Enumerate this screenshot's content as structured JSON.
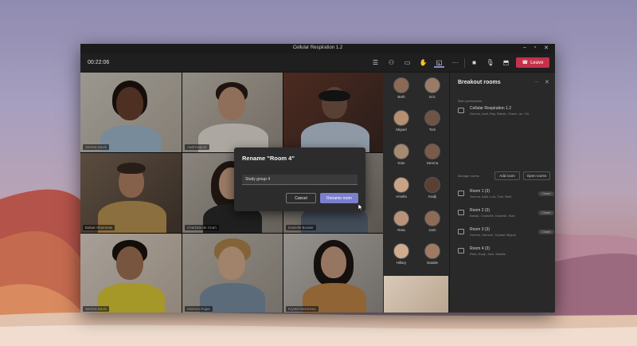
{
  "window": {
    "title": "Cellular Respiration 1.2"
  },
  "toolbar": {
    "timer": "00:22:06",
    "leave_label": "Leave",
    "icons": [
      "list-icon",
      "people-icon",
      "chat-icon",
      "raise-hand-icon",
      "breakout-rooms-icon",
      "more-icon",
      "camera-icon",
      "mic-icon",
      "share-icon"
    ]
  },
  "grid": {
    "tiles": [
      {
        "name": "Serena Davis"
      },
      {
        "name": "Aadi Kapoor"
      },
      {
        "name": ""
      },
      {
        "name": "Babak Shammas"
      },
      {
        "name": "Charlotte de Crum"
      },
      {
        "name": "Danielle Booker"
      },
      {
        "name": "Serena Davis"
      },
      {
        "name": "Harmon Rojas"
      },
      {
        "name": "Krystal McKinney"
      }
    ]
  },
  "participants": [
    {
      "name": "Beth"
    },
    {
      "name": "Eric"
    },
    {
      "name": "Miguel"
    },
    {
      "name": "Tom"
    },
    {
      "name": "Kian"
    },
    {
      "name": "Serena"
    },
    {
      "name": "Amelia"
    },
    {
      "name": "Kadji"
    },
    {
      "name": "Reta"
    },
    {
      "name": "Josh"
    },
    {
      "name": "Hillary"
    },
    {
      "name": "Natalie"
    }
  ],
  "breakout": {
    "title": "Breakout rooms",
    "main_label": "Main participants",
    "meeting_name": "Cellular Respiration 1.2",
    "meeting_members": "Serena, Aadi, Ray, Babak, Charlo, an +16",
    "manage_label": "Manage rooms",
    "add_room": "Add room",
    "open_rooms": "Open rooms",
    "rooms": [
      {
        "name": "Room 1 (3)",
        "members": "Serena, Aadi, Luis, Tom, Beth",
        "status": "Closed"
      },
      {
        "name": "Room 2 (3)",
        "members": "Babak, Charlotte, Danielle, Kian",
        "status": "Closed"
      },
      {
        "name": "Room 3 (3)",
        "members": "Serena, Harmon, Krystal, Miguel",
        "status": "Closed"
      },
      {
        "name": "Room 4 (3)",
        "members": "Reta, Kadji, Josh, Natalie",
        "status": ""
      }
    ]
  },
  "dialog": {
    "title": "Rename \"Room 4\"",
    "input_value": "Study group 4",
    "cancel_label": "Cancel",
    "rename_label": "Rename room"
  }
}
